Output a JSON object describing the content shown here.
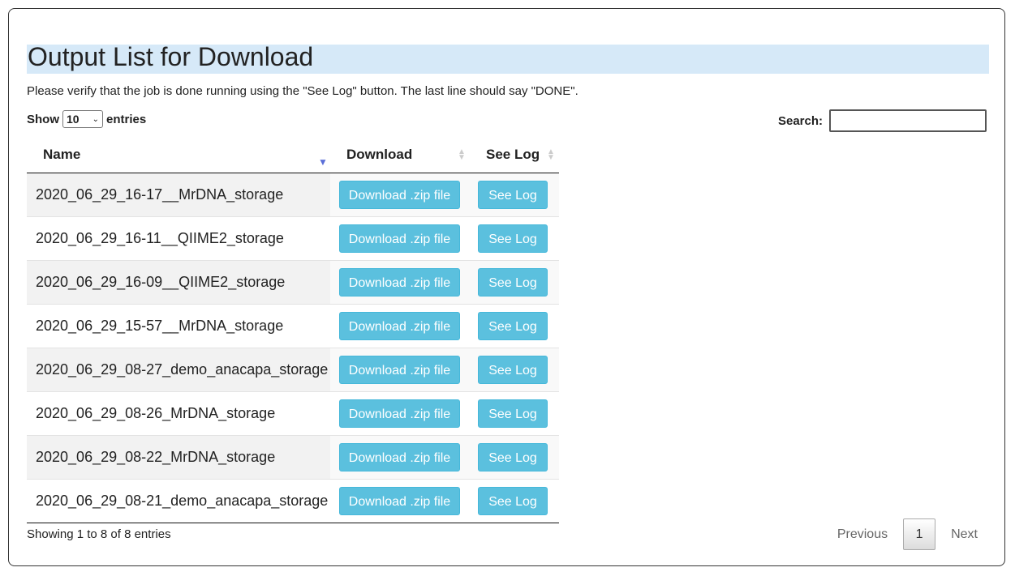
{
  "page": {
    "title": "Output List for Download",
    "notice": "Please verify that the job is done running using the \"See Log\" button. The last line should say \"DONE\"."
  },
  "length_control": {
    "prefix": "Show",
    "selected": "10",
    "suffix": "entries"
  },
  "search": {
    "label": "Search:",
    "value": ""
  },
  "table": {
    "columns": {
      "name": "Name",
      "download": "Download",
      "log": "See Log"
    },
    "sort": {
      "column": "Name",
      "direction": "descending"
    },
    "rows": [
      {
        "name": "2020_06_29_16-17__MrDNA_storage",
        "download": "Download .zip file",
        "log": "See Log"
      },
      {
        "name": "2020_06_29_16-11__QIIME2_storage",
        "download": "Download .zip file",
        "log": "See Log"
      },
      {
        "name": "2020_06_29_16-09__QIIME2_storage",
        "download": "Download .zip file",
        "log": "See Log"
      },
      {
        "name": "2020_06_29_15-57__MrDNA_storage",
        "download": "Download .zip file",
        "log": "See Log"
      },
      {
        "name": "2020_06_29_08-27_demo_anacapa_storage",
        "download": "Download .zip file",
        "log": "See Log"
      },
      {
        "name": "2020_06_29_08-26_MrDNA_storage",
        "download": "Download .zip file",
        "log": "See Log"
      },
      {
        "name": "2020_06_29_08-22_MrDNA_storage",
        "download": "Download .zip file",
        "log": "See Log"
      },
      {
        "name": "2020_06_29_08-21_demo_anacapa_storage",
        "download": "Download .zip file",
        "log": "See Log"
      }
    ]
  },
  "footer": {
    "info": "Showing 1 to 8 of 8 entries",
    "pagination": {
      "previous": "Previous",
      "current": "1",
      "next": "Next"
    }
  },
  "colors": {
    "button": "#5bc0de",
    "title_bar": "#d6e9f8",
    "sort_active": "#5b6fd8"
  }
}
